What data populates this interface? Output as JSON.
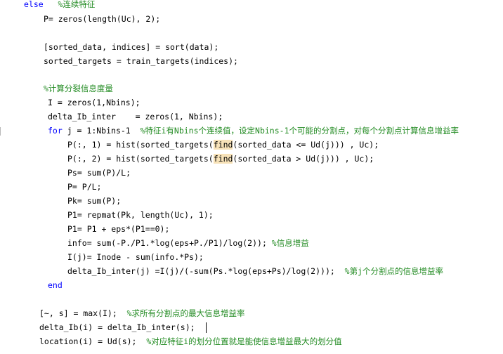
{
  "editor": {
    "lines": [
      {
        "tokens": [
          {
            "t": "else",
            "s": "kw"
          },
          {
            "t": "   "
          },
          {
            "t": "%连续特征",
            "s": "cm"
          }
        ]
      },
      {
        "tokens": [
          {
            "t": "P= zeros(length(Uc), 2);"
          }
        ]
      },
      {
        "tokens": []
      },
      {
        "tokens": [
          {
            "t": "[sorted_data, indices] = sort(data);"
          }
        ]
      },
      {
        "tokens": [
          {
            "t": "sorted_targets = train_targets(indices);"
          }
        ]
      },
      {
        "tokens": []
      },
      {
        "tokens": [
          {
            "t": "%计算分裂信息度量",
            "s": "cm"
          }
        ]
      },
      {
        "tokens": [
          {
            "t": "I = zeros(1,Nbins);"
          }
        ]
      },
      {
        "tokens": [
          {
            "t": "delta_Ib_inter    = zeros(1, Nbins);"
          }
        ]
      },
      {
        "tokens": [
          {
            "t": "for",
            "s": "kw"
          },
          {
            "t": " j = 1:Nbins-1  "
          },
          {
            "t": "%特征i有Nbins个连续值，设定Nbins-1个可能的分割点，对每个分割点计算信息增益率",
            "s": "cm"
          }
        ]
      },
      {
        "tokens": [
          {
            "t": "P(:, 1) = hist(sorted_targets("
          },
          {
            "t": "find",
            "s": "hl"
          },
          {
            "t": "(sorted_data <= Ud(j))) , Uc);"
          }
        ]
      },
      {
        "tokens": [
          {
            "t": "P(:, 2) = hist(sorted_targets("
          },
          {
            "t": "find",
            "s": "hl"
          },
          {
            "t": "(sorted_data > Ud(j))) , Uc);"
          }
        ]
      },
      {
        "tokens": [
          {
            "t": "Ps= sum(P)/L;"
          }
        ]
      },
      {
        "tokens": [
          {
            "t": "P= P/L;"
          }
        ]
      },
      {
        "tokens": [
          {
            "t": "Pk= sum(P);"
          }
        ]
      },
      {
        "tokens": [
          {
            "t": "P1= repmat(Pk, length(Uc), 1);"
          }
        ]
      },
      {
        "tokens": [
          {
            "t": "P1= P1 + eps*(P1==0);"
          }
        ]
      },
      {
        "tokens": [
          {
            "t": "info= sum(-P./P1.*log(eps+P./P1)/log(2)); "
          },
          {
            "t": "%信息增益",
            "s": "cm"
          }
        ]
      },
      {
        "tokens": [
          {
            "t": "I(j)= Inode - sum(info.*Ps);"
          }
        ]
      },
      {
        "tokens": [
          {
            "t": "delta_Ib_inter(j) =I(j)/(-sum(Ps.*log(eps+Ps)/log(2)));  "
          },
          {
            "t": "%第j个分割点的信息增益率",
            "s": "cm"
          }
        ]
      },
      {
        "tokens": [
          {
            "t": "end",
            "s": "kw"
          }
        ]
      },
      {
        "tokens": []
      },
      {
        "tokens": [
          {
            "t": "[~, s] = max(I);  "
          },
          {
            "t": "%求所有分割点的最大信息增益率",
            "s": "cm"
          }
        ]
      },
      {
        "tokens": [
          {
            "t": "delta_Ib(i) = delta_Ib_inter(s);"
          }
        ]
      },
      {
        "tokens": [
          {
            "t": "location(i) = Ud(s);  "
          },
          {
            "t": "%对应特征i的划分位置就是能使信息增益最大的划分值",
            "s": "cm"
          }
        ]
      }
    ]
  },
  "colors": {
    "keyword": "#0000ff",
    "comment": "#228b22",
    "text": "#000000",
    "match_highlight": "#f7e2b8"
  }
}
